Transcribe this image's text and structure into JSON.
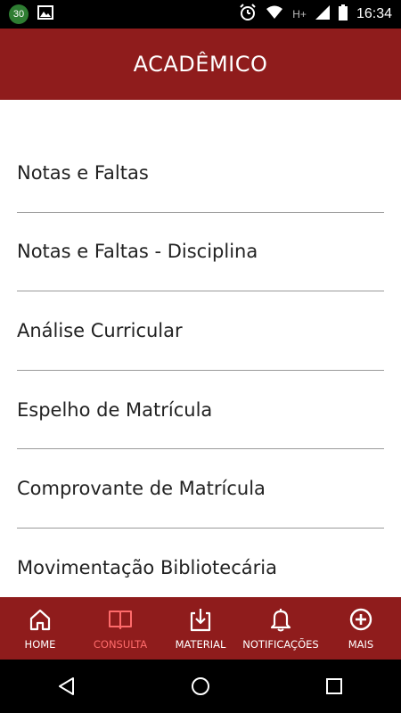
{
  "status_bar": {
    "notification_badge": "30",
    "network_type": "H+",
    "time": "16:34"
  },
  "header": {
    "title": "ACADÊMICO"
  },
  "menu": {
    "items": [
      {
        "label": "Notas e Faltas"
      },
      {
        "label": "Notas e Faltas - Disciplina"
      },
      {
        "label": "Análise Curricular"
      },
      {
        "label": "Espelho de Matrícula"
      },
      {
        "label": "Comprovante de Matrícula"
      },
      {
        "label": "Movimentação Bibliotecária"
      }
    ]
  },
  "bottom_nav": {
    "items": [
      {
        "label": "HOME",
        "icon": "home-icon",
        "active": false
      },
      {
        "label": "CONSULTA",
        "icon": "book-icon",
        "active": true
      },
      {
        "label": "MATERIAL",
        "icon": "download-icon",
        "active": false
      },
      {
        "label": "NOTIFICAÇÕES",
        "icon": "bell-icon",
        "active": false
      },
      {
        "label": "MAIS",
        "icon": "plus-circle-icon",
        "active": false
      }
    ]
  },
  "colors": {
    "brand": "#8f1c1c",
    "active_nav": "#ff6b6b",
    "status_bar": "#000000",
    "divider": "#9a9a9a"
  }
}
